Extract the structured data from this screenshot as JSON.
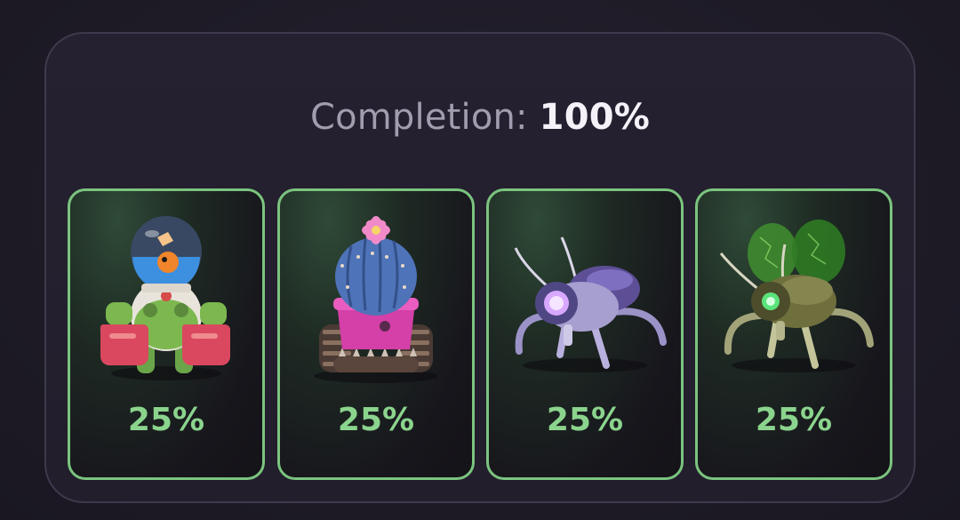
{
  "completion": {
    "label": "Completion:",
    "value": "100%"
  },
  "cards": [
    {
      "name": "fishbowl-robot",
      "percent": "25%"
    },
    {
      "name": "cactus-tank",
      "percent": "25%"
    },
    {
      "name": "purple-beetle-bot",
      "percent": "25%"
    },
    {
      "name": "green-beetle-bot",
      "percent": "25%"
    }
  ],
  "colors": {
    "accent_green": "#7bc47f",
    "percent_text": "#8bd48d",
    "panel_border": "#3e3a4d",
    "background": "#1d1a26"
  }
}
